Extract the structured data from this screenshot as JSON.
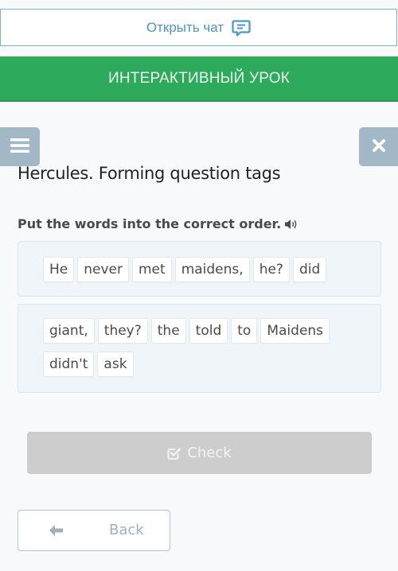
{
  "chat_bar": {
    "label": "Открыть чат",
    "icon": "chat-icon"
  },
  "banner": {
    "title": "ИНТЕРАКТИВНЫЙ УРОК"
  },
  "nav": {
    "menu_icon": "hamburger-menu-icon",
    "close_icon": "close-icon"
  },
  "lesson": {
    "title": "Hercules. Forming question tags",
    "instruction": "Put the words into the correct order.",
    "instruction_icon": "speaker-icon"
  },
  "answer_box": {
    "words": [
      "He",
      "never",
      "met",
      "maidens,",
      "he?",
      "did"
    ]
  },
  "word_bank": {
    "words": [
      "giant,",
      "they?",
      "the",
      "told",
      "to",
      "Maidens",
      "didn't",
      "ask"
    ]
  },
  "check_button": {
    "label": "Check",
    "icon": "checkbox-icon",
    "state": "disabled"
  },
  "back_button": {
    "label": "Back",
    "icon": "arrow-left-icon"
  },
  "colors": {
    "banner_green": "#2eaa5c",
    "chat_blue": "#4a96c4",
    "nav_button_gray": "#a3b8c6",
    "check_disabled": "#cdcdcd"
  }
}
